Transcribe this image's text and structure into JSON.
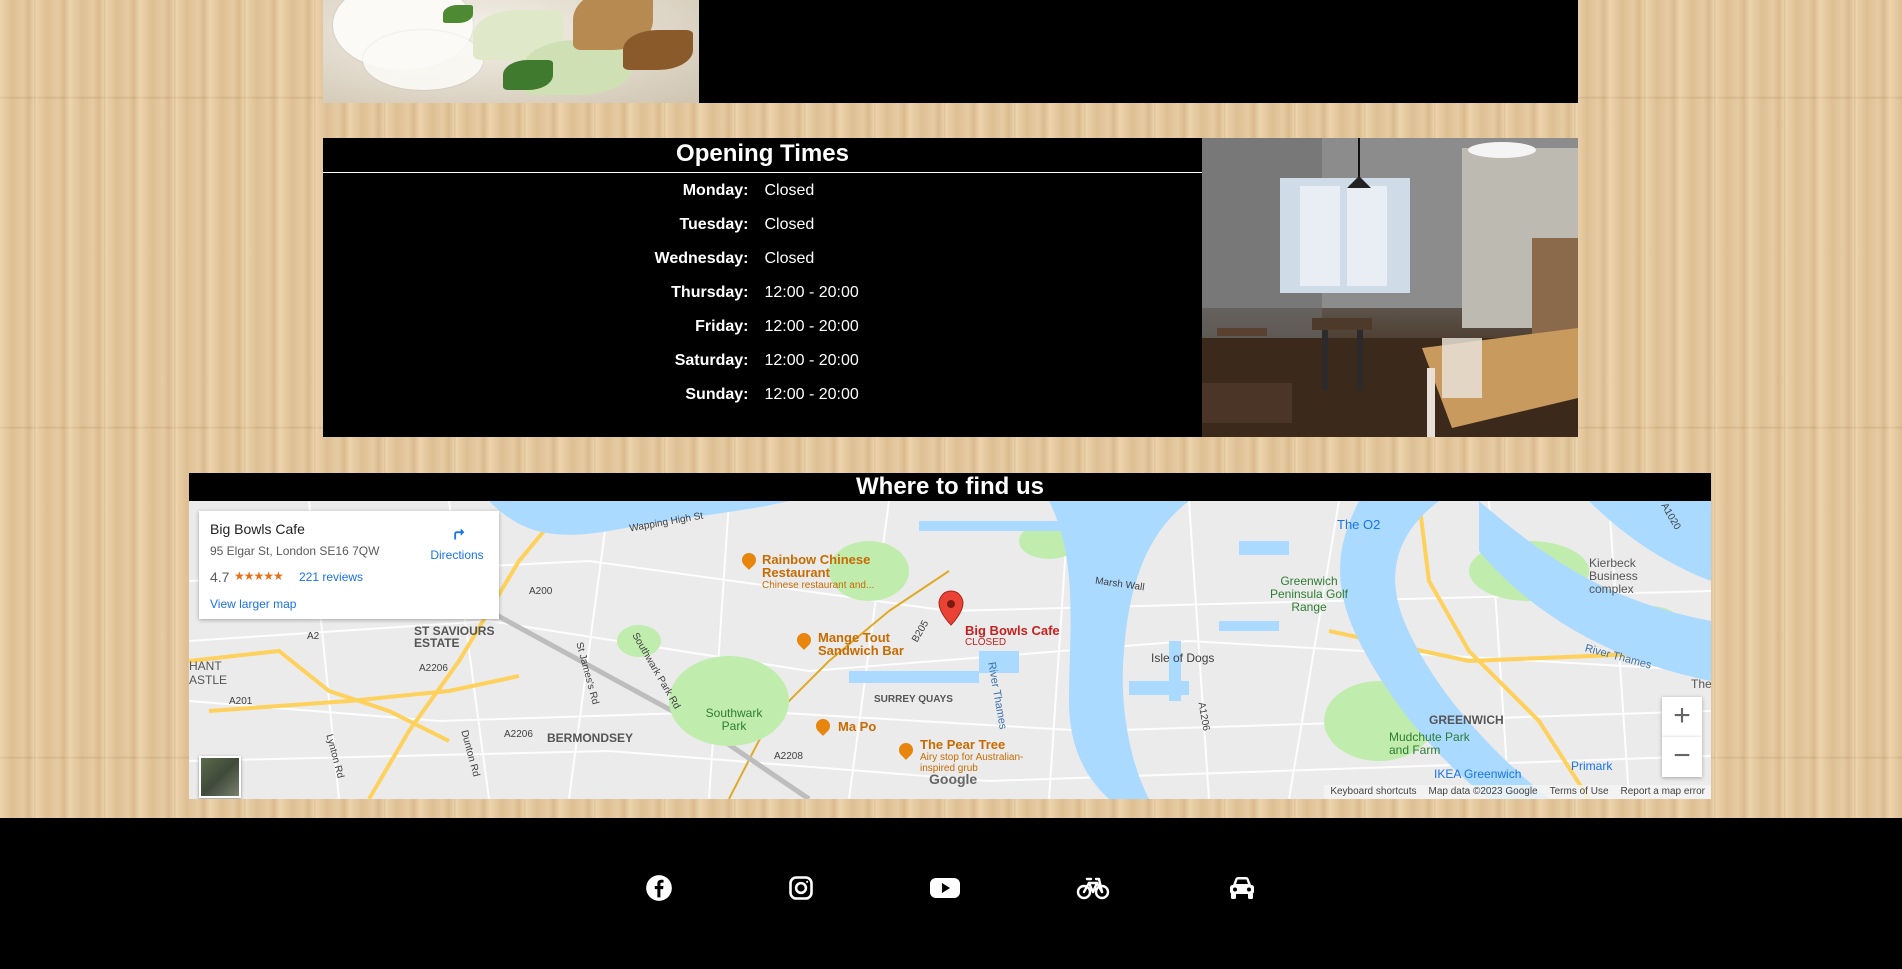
{
  "opening": {
    "title": "Opening Times",
    "rows": [
      {
        "day": "Monday:",
        "time": "Closed"
      },
      {
        "day": "Tuesday:",
        "time": "Closed"
      },
      {
        "day": "Wednesday:",
        "time": "Closed"
      },
      {
        "day": "Thursday:",
        "time": "12:00 - 20:00"
      },
      {
        "day": "Friday:",
        "time": "12:00 - 20:00"
      },
      {
        "day": "Saturday:",
        "time": "12:00 - 20:00"
      },
      {
        "day": "Sunday:",
        "time": "12:00 - 20:00"
      }
    ]
  },
  "find": {
    "title": "Where to find us"
  },
  "map": {
    "card": {
      "name": "Big Bowls Cafe",
      "address": "95 Elgar St, London SE16 7QW",
      "rating": "4.7",
      "stars": "★★★★★",
      "reviews": "221 reviews",
      "larger_map": "View larger map",
      "directions": "Directions"
    },
    "marker": {
      "name": "Big Bowls Cafe",
      "status": "CLOSED"
    },
    "labels": [
      "Wapping High St",
      "ST SAVIOURS ESTATE",
      "HANT ASTLE",
      "BERMONDSEY",
      "Southwark Park",
      "SURREY QUAYS",
      "Isle of Dogs",
      "Marsh Wall",
      "GREENWICH",
      "River Thames",
      "River Thames",
      "Mudchute Park and Farm",
      "The O2",
      "Kierbeck Business complex",
      "Greenwich Peninsula Golf Range",
      "The Tha",
      "IKEA Greenwich",
      "Primark",
      "A200",
      "A2",
      "A2206",
      "A201",
      "A2208",
      "B205",
      "A1206",
      "A1020",
      "A2206",
      "St James's Rd",
      "Southwark Park Rd",
      "Dunton Rd",
      "Lynton Rd"
    ],
    "pois": [
      {
        "name": "Rainbow Chinese Restaurant",
        "sub": "Chinese restaurant and..."
      },
      {
        "name": "Mange Tout Sandwich Bar",
        "sub": ""
      },
      {
        "name": "Ma Po",
        "sub": ""
      },
      {
        "name": "The Pear Tree",
        "sub": "Airy stop for Australian-inspired grub"
      }
    ],
    "zoom_in": "+",
    "zoom_out": "−",
    "footer": [
      "Keyboard shortcuts",
      "Map data ©2023 Google",
      "Terms of Use",
      "Report a map error"
    ],
    "google": "Google",
    "colors": {
      "water": "#aadaff",
      "park": "#c0ecae",
      "road": "#ffffff",
      "major_road": "#fdd15b",
      "poi": "#e8850c",
      "marker": "#ea4335"
    }
  },
  "social": {
    "icons": [
      "facebook-icon",
      "instagram-icon",
      "youtube-icon",
      "bicycle-icon",
      "car-icon"
    ]
  }
}
